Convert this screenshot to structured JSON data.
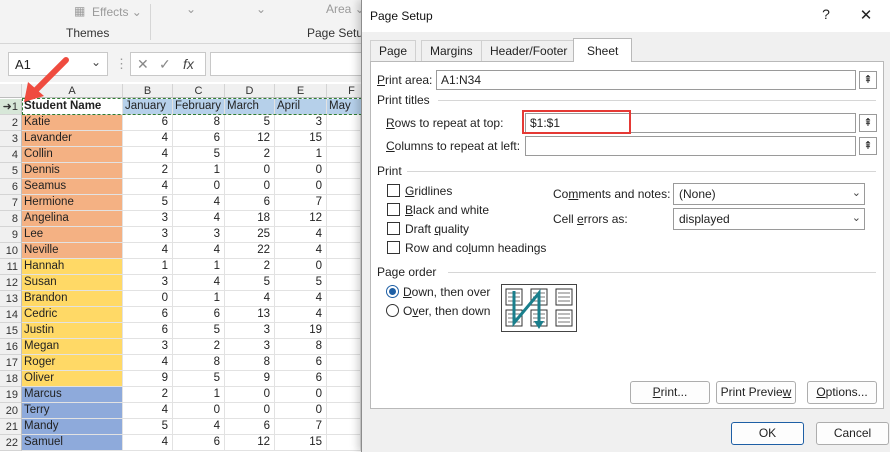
{
  "ribbon": {
    "effects_label": "Effects",
    "themes_label": "Themes",
    "page_setup_group": "Page Setup",
    "area_label": "Area"
  },
  "formula_bar": {
    "name_box": "A1",
    "fx": "fx",
    "formula": ""
  },
  "sheet": {
    "columns": [
      "A",
      "B",
      "C",
      "D",
      "E",
      "F"
    ],
    "header": [
      "Student Name",
      "January",
      "February",
      "March",
      "April",
      "May"
    ],
    "rows": [
      {
        "n": "2",
        "name": "Katie",
        "v": [
          "6",
          "8",
          "5",
          "3"
        ],
        "color": "#f4b183"
      },
      {
        "n": "3",
        "name": "Lavander",
        "v": [
          "4",
          "6",
          "12",
          "15"
        ],
        "color": "#f4b183"
      },
      {
        "n": "4",
        "name": "Collin",
        "v": [
          "4",
          "5",
          "2",
          "1"
        ],
        "color": "#f4b183"
      },
      {
        "n": "5",
        "name": "Dennis",
        "v": [
          "2",
          "1",
          "0",
          "0"
        ],
        "color": "#f4b183"
      },
      {
        "n": "6",
        "name": "Seamus",
        "v": [
          "4",
          "0",
          "0",
          "0"
        ],
        "color": "#f4b183"
      },
      {
        "n": "7",
        "name": "Hermione",
        "v": [
          "5",
          "4",
          "6",
          "7"
        ],
        "color": "#f4b183"
      },
      {
        "n": "8",
        "name": "Angelina",
        "v": [
          "3",
          "4",
          "18",
          "12"
        ],
        "color": "#f4b183"
      },
      {
        "n": "9",
        "name": "Lee",
        "v": [
          "3",
          "3",
          "25",
          "4"
        ],
        "color": "#f4b183"
      },
      {
        "n": "10",
        "name": "Neville",
        "v": [
          "4",
          "4",
          "22",
          "4"
        ],
        "color": "#f4b183"
      },
      {
        "n": "11",
        "name": "Hannah",
        "v": [
          "1",
          "1",
          "2",
          "0"
        ],
        "color": "#ffd966"
      },
      {
        "n": "12",
        "name": "Susan",
        "v": [
          "3",
          "4",
          "5",
          "5"
        ],
        "color": "#ffd966"
      },
      {
        "n": "13",
        "name": "Brandon",
        "v": [
          "0",
          "1",
          "4",
          "4"
        ],
        "color": "#ffd966"
      },
      {
        "n": "14",
        "name": "Cedric",
        "v": [
          "6",
          "6",
          "13",
          "4"
        ],
        "color": "#ffd966"
      },
      {
        "n": "15",
        "name": "Justin",
        "v": [
          "6",
          "5",
          "3",
          "19"
        ],
        "color": "#ffd966"
      },
      {
        "n": "16",
        "name": "Megan",
        "v": [
          "3",
          "2",
          "3",
          "8"
        ],
        "color": "#ffd966"
      },
      {
        "n": "17",
        "name": "Roger",
        "v": [
          "4",
          "8",
          "8",
          "6"
        ],
        "color": "#ffd966"
      },
      {
        "n": "18",
        "name": "Oliver",
        "v": [
          "9",
          "5",
          "9",
          "6"
        ],
        "color": "#ffd966"
      },
      {
        "n": "19",
        "name": "Marcus",
        "v": [
          "2",
          "1",
          "0",
          "0"
        ],
        "color": "#8eaadb"
      },
      {
        "n": "20",
        "name": "Terry",
        "v": [
          "4",
          "0",
          "0",
          "0"
        ],
        "color": "#8eaadb"
      },
      {
        "n": "21",
        "name": "Mandy",
        "v": [
          "5",
          "4",
          "6",
          "7"
        ],
        "color": "#8eaadb"
      },
      {
        "n": "22",
        "name": "Samuel",
        "v": [
          "4",
          "6",
          "12",
          "15"
        ],
        "color": "#8eaadb"
      }
    ]
  },
  "dialog": {
    "title": "Page Setup",
    "help": "?",
    "close": "✕",
    "tabs": [
      "Page",
      "Margins",
      "Header/Footer",
      "Sheet"
    ],
    "active_tab": "Sheet",
    "print_area_label": "Print area:",
    "print_area_value": "A1:N34",
    "print_titles_label": "Print titles",
    "rows_repeat_label": "Rows to repeat at top:",
    "rows_repeat_value": "$1:$1",
    "cols_repeat_label": "Columns to repeat at left:",
    "cols_repeat_value": "",
    "print_label": "Print",
    "gridlines": "Gridlines",
    "black_white": "Black and white",
    "draft_quality": "Draft quality",
    "row_col_headings": "Row and column headings",
    "comments_label": "Comments and notes:",
    "comments_value": "(None)",
    "cell_errors_label": "Cell errors as:",
    "cell_errors_value": "displayed",
    "page_order_label": "Page order",
    "down_then_over": "Down, then over",
    "over_then_down": "Over, then down",
    "print_btn": "Print...",
    "preview_btn": "Print Preview",
    "options_btn": "Options...",
    "ok_btn": "OK",
    "cancel_btn": "Cancel"
  },
  "colors": {
    "group1": "#f4b183",
    "group2": "#ffd966",
    "group3": "#8eaadb",
    "header_fill": "#b6d0ea",
    "highlight": "#e53935",
    "accent": "#1e5fa5"
  }
}
